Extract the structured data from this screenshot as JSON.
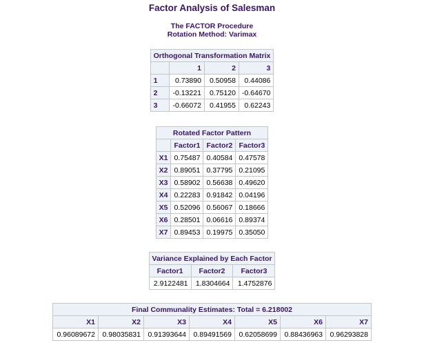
{
  "title": "Factor Analysis of Salesman",
  "procedure": "The FACTOR Procedure",
  "rotation": "Rotation Method: Varimax",
  "transform": {
    "caption": "Orthogonal Transformation Matrix",
    "columns": [
      "1",
      "2",
      "3"
    ],
    "rows": [
      {
        "label": "1",
        "values": [
          "0.73890",
          "0.50958",
          "0.44086"
        ]
      },
      {
        "label": "2",
        "values": [
          "-0.13221",
          "0.75120",
          "-0.64670"
        ]
      },
      {
        "label": "3",
        "values": [
          "-0.66072",
          "0.41955",
          "0.62243"
        ]
      }
    ]
  },
  "pattern": {
    "caption": "Rotated Factor Pattern",
    "columns": [
      "Factor1",
      "Factor2",
      "Factor3"
    ],
    "rows": [
      {
        "label": "X1",
        "values": [
          "0.75487",
          "0.40584",
          "0.47578"
        ]
      },
      {
        "label": "X2",
        "values": [
          "0.89051",
          "0.37795",
          "0.21095"
        ]
      },
      {
        "label": "X3",
        "values": [
          "0.58902",
          "0.56638",
          "0.49620"
        ]
      },
      {
        "label": "X4",
        "values": [
          "0.22283",
          "0.91842",
          "0.04196"
        ]
      },
      {
        "label": "X5",
        "values": [
          "0.52096",
          "0.56067",
          "0.18666"
        ]
      },
      {
        "label": "X6",
        "values": [
          "0.28501",
          "0.06616",
          "0.89374"
        ]
      },
      {
        "label": "X7",
        "values": [
          "0.89453",
          "0.19975",
          "0.35050"
        ]
      }
    ]
  },
  "variance": {
    "caption": "Variance Explained by Each Factor",
    "columns": [
      "Factor1",
      "Factor2",
      "Factor3"
    ],
    "values": [
      "2.9122481",
      "1.8304664",
      "1.4752876"
    ]
  },
  "communality": {
    "caption": "Final Communality Estimates: Total = 6.218002",
    "columns": [
      "X1",
      "X2",
      "X3",
      "X4",
      "X5",
      "X6",
      "X7"
    ],
    "values": [
      "0.96089672",
      "0.98035831",
      "0.91393644",
      "0.89491569",
      "0.62058699",
      "0.88436963",
      "0.96293828"
    ]
  }
}
